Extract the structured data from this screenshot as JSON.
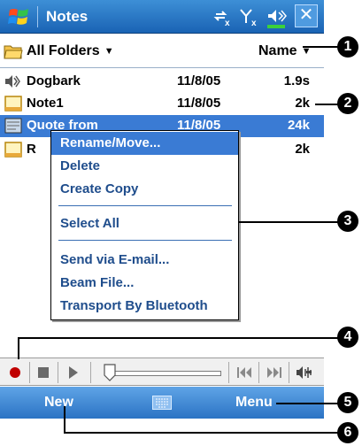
{
  "titlebar": {
    "app_title": "Notes",
    "icons": [
      "windows-logo-icon",
      "connectivity-icon",
      "signal-icon",
      "speaker-icon"
    ],
    "close_label": "✕"
  },
  "folderbar": {
    "folder_label": "All Folders",
    "sort_label": "Name"
  },
  "files": [
    {
      "icon": "speaker-note-icon",
      "name": "Dogbark",
      "date": "11/8/05",
      "size": "1.9s",
      "selected": false
    },
    {
      "icon": "note-icon",
      "name": "Note1",
      "date": "11/8/05",
      "size": "2k",
      "selected": false
    },
    {
      "icon": "ink-note-icon",
      "name": "Quote from",
      "date": "11/8/05",
      "size": "24k",
      "selected": true
    },
    {
      "icon": "note-icon",
      "name": "R",
      "date": "",
      "size": "2k",
      "selected": false
    }
  ],
  "context_menu": {
    "items": [
      "Rename/Move...",
      "Delete",
      "Create Copy",
      "Select All",
      "Send via E-mail...",
      "Beam File...",
      "Transport By Bluetooth"
    ],
    "highlighted_index": 0
  },
  "recording_toolbar": {
    "buttons": [
      "record-icon",
      "stop-icon",
      "play-icon",
      "skip-back-icon",
      "skip-forward-icon",
      "volume-icon"
    ],
    "slider_position": 0
  },
  "menubar": {
    "left_label": "New",
    "right_label": "Menu",
    "keyboard_icon": "keyboard-icon"
  },
  "callouts": [
    "1",
    "2",
    "3",
    "4",
    "5",
    "6"
  ],
  "colors": {
    "titlebar": "#1a63b4",
    "selection": "#3a7bd4",
    "menu_text": "#1f4d8c",
    "record_red": "#c00000"
  }
}
